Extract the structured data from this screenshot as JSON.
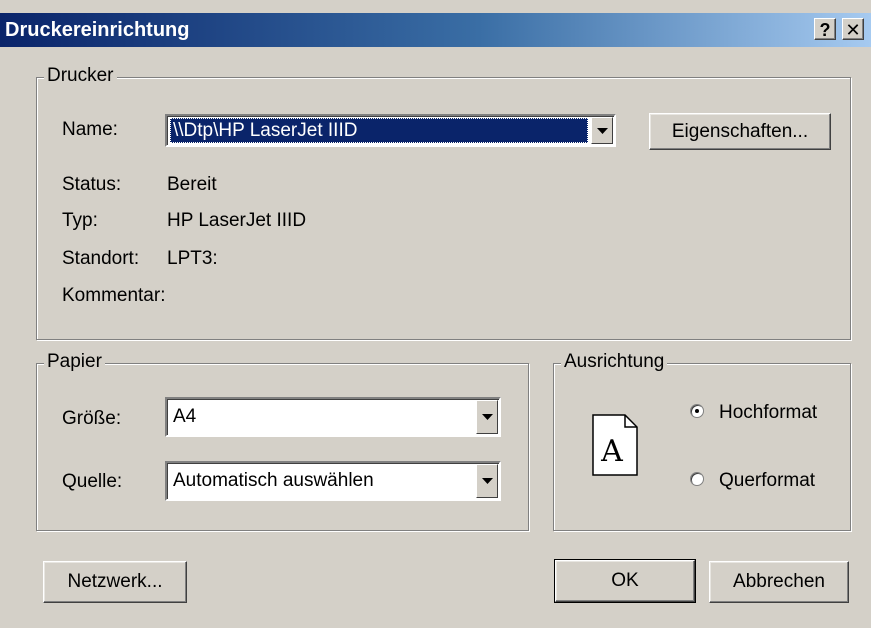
{
  "window": {
    "title": "Druckereinrichtung",
    "help_label": "?",
    "close_label": "✕"
  },
  "printer": {
    "group_label": "Drucker",
    "name_label": "Name:",
    "name_value": "\\\\Dtp\\HP LaserJet IIID",
    "properties_button": "Eigenschaften...",
    "status_label": "Status:",
    "status_value": "Bereit",
    "type_label": "Typ:",
    "type_value": "HP LaserJet IIID",
    "location_label": "Standort:",
    "location_value": "LPT3:",
    "comment_label": "Kommentar:",
    "comment_value": ""
  },
  "paper": {
    "group_label": "Papier",
    "size_label": "Größe:",
    "size_value": "A4",
    "source_label": "Quelle:",
    "source_value": "Automatisch auswählen"
  },
  "orientation": {
    "group_label": "Ausrichtung",
    "preview_letter": "A",
    "portrait_label": "Hochformat",
    "portrait_checked": true,
    "landscape_label": "Querformat",
    "landscape_checked": false
  },
  "buttons": {
    "network": "Netzwerk...",
    "ok": "OK",
    "cancel": "Abbrechen"
  }
}
